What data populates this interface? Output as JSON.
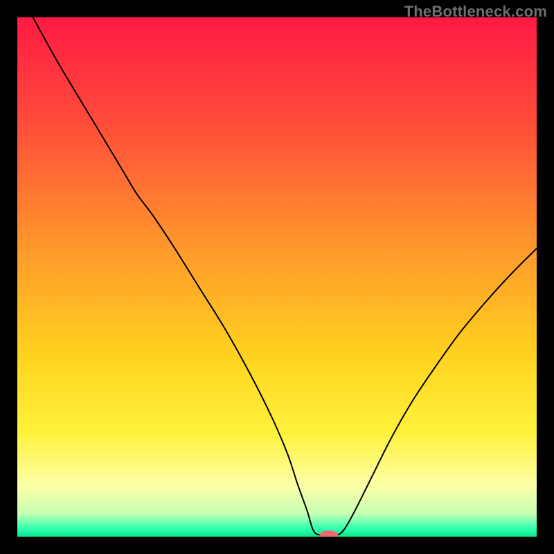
{
  "watermark": "TheBottleneck.com",
  "chart_data": {
    "type": "line",
    "title": "",
    "xlabel": "",
    "ylabel": "",
    "xlim": [
      0,
      100
    ],
    "ylim": [
      0,
      100
    ],
    "grid": false,
    "legend": false,
    "background_gradient": {
      "stops": [
        {
          "pos": 0.0,
          "color": "#ff1a43"
        },
        {
          "pos": 0.2,
          "color": "#ff4b3a"
        },
        {
          "pos": 0.45,
          "color": "#ff9a2b"
        },
        {
          "pos": 0.65,
          "color": "#ffd21f"
        },
        {
          "pos": 0.8,
          "color": "#fff23b"
        },
        {
          "pos": 0.9,
          "color": "#fdffa6"
        },
        {
          "pos": 0.955,
          "color": "#c8ffb3"
        },
        {
          "pos": 0.985,
          "color": "#2fffb0"
        },
        {
          "pos": 1.0,
          "color": "#09e88a"
        }
      ]
    },
    "series": [
      {
        "name": "bottleneck-curve",
        "color": "#000000",
        "x": [
          3.0,
          8.0,
          14.0,
          20.0,
          23.0,
          26.0,
          30.0,
          35.0,
          40.0,
          45.0,
          49.0,
          52.0,
          54.0,
          55.8,
          57.0,
          58.5,
          61.5,
          63.0,
          65.0,
          68.0,
          72.0,
          76.0,
          80.0,
          85.0,
          90.0,
          95.0,
          100.0
        ],
        "y": [
          100.0,
          91.0,
          81.0,
          71.0,
          66.0,
          62.0,
          56.0,
          48.0,
          40.0,
          31.0,
          23.0,
          16.0,
          10.0,
          5.0,
          1.2,
          0.3,
          0.3,
          1.5,
          5.0,
          11.0,
          19.0,
          26.0,
          32.0,
          39.0,
          45.0,
          50.5,
          55.5
        ]
      }
    ],
    "marker": {
      "name": "optimal-point",
      "x": 60.0,
      "y": 0.3,
      "color": "#ef6a6f",
      "rx": 1.8,
      "ry": 0.9
    }
  }
}
